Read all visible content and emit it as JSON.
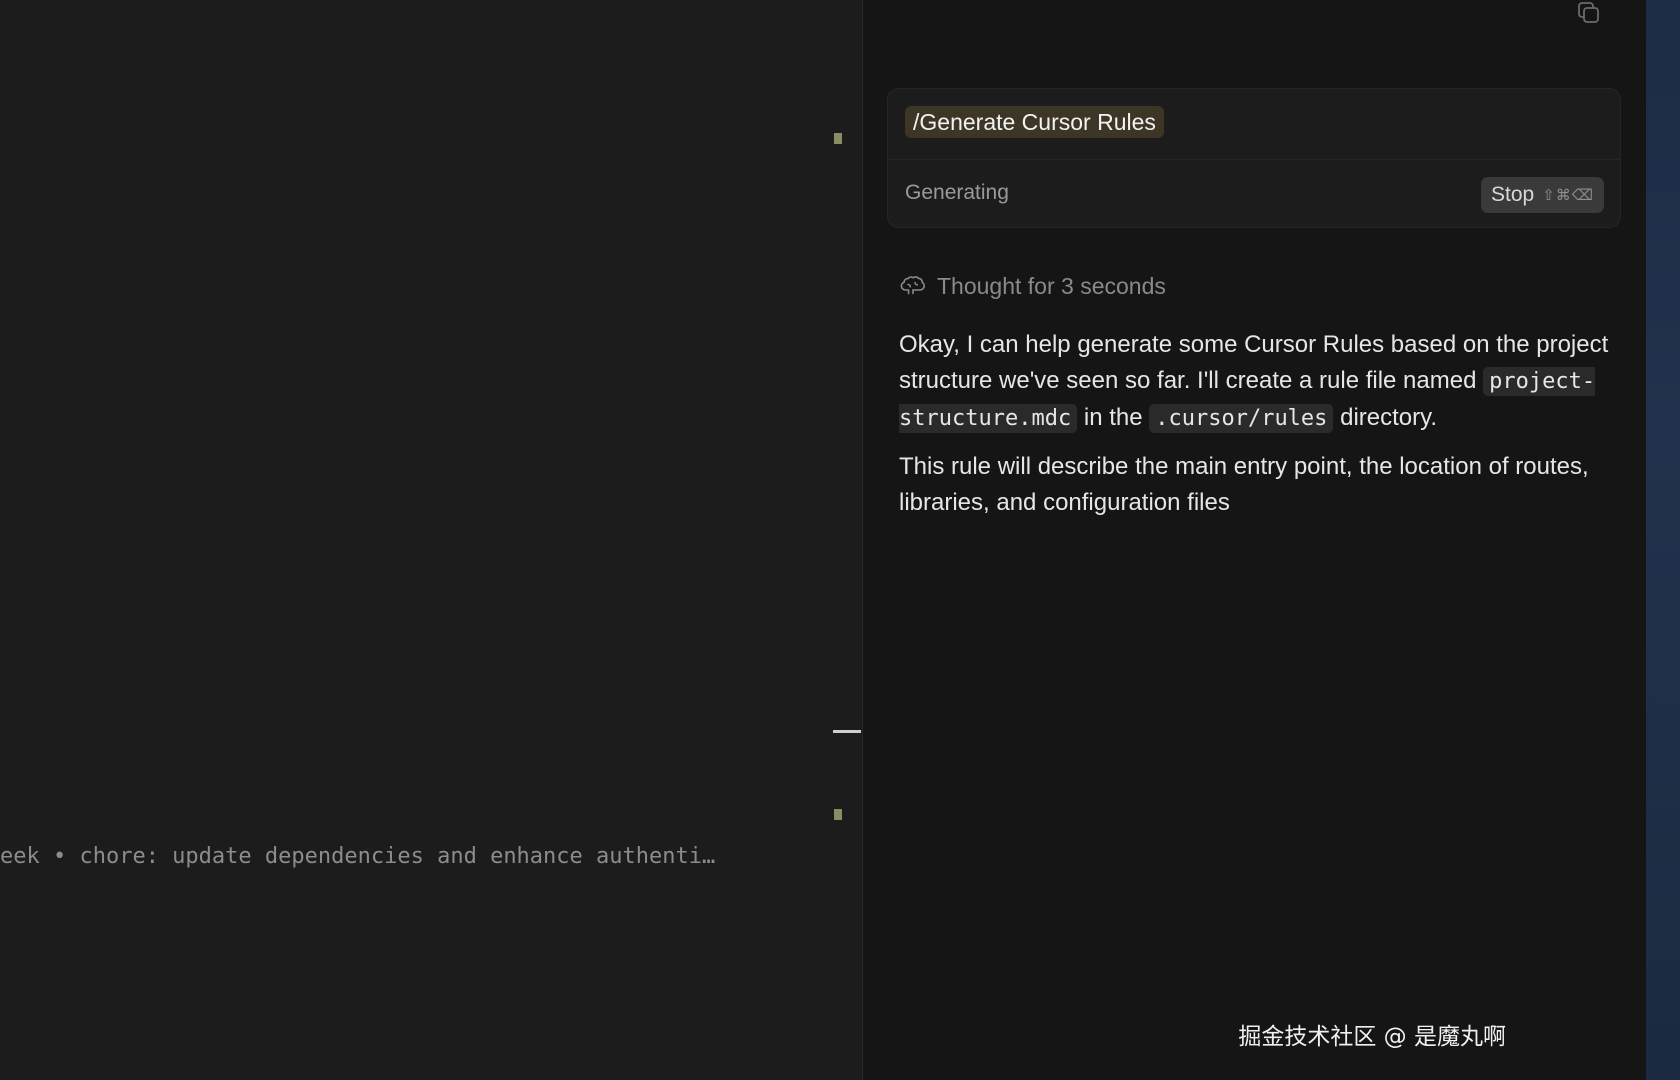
{
  "editor": {
    "git_blame": "eek • chore: update dependencies and enhance authenti…"
  },
  "chat": {
    "command": "/Generate Cursor Rules",
    "status": "Generating",
    "stop_button": {
      "label": "Stop",
      "shortcut": "⇧⌘⌫"
    },
    "thought": "Thought for 3 seconds",
    "response": {
      "p1_a": "Okay, I can help generate some Cursor Rules based on the project structure we've seen so far. I'll create a rule file named ",
      "p1_code1": "project-structure.mdc",
      "p1_b": " in the ",
      "p1_code2": ".cursor/rules",
      "p1_c": " directory.",
      "p2": "This rule will describe the main entry point, the location of routes, libraries, and configuration files"
    }
  },
  "watermark": "掘金技术社区 @ 是魔丸啊",
  "icons": {
    "copy": "copy-icon",
    "brain": "brain-icon"
  },
  "colors": {
    "editor_bg": "#1c1c1c",
    "chat_bg": "#151515",
    "command_pill": "#3d3526",
    "gutter_modified": "#8a8d62"
  }
}
